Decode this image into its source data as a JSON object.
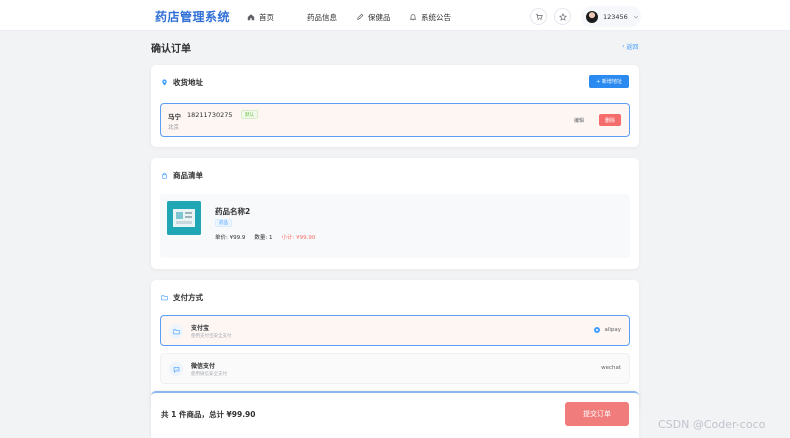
{
  "header": {
    "logo": "药店管理系统",
    "nav": [
      {
        "label": "首页",
        "icon": "home-icon"
      },
      {
        "label": "药品信息",
        "icon": ""
      },
      {
        "label": "保健品",
        "icon": "edit-icon"
      },
      {
        "label": "系统公告",
        "icon": "bell-icon"
      }
    ],
    "cart_icon": "cart-icon",
    "star_icon": "star-icon",
    "user": {
      "name": "123456"
    }
  },
  "page": {
    "title": "确认订单",
    "back_label": "返回"
  },
  "address": {
    "title": "收货地址",
    "add_label": "+ 新增地址",
    "entry": {
      "name": "马宁",
      "phone": "18211730275",
      "tag": "默认",
      "detail": "北京",
      "edit_label": "编辑",
      "delete_label": "删除"
    }
  },
  "goods": {
    "title": "商品清单",
    "items": [
      {
        "name": "药品名称2",
        "tag": "药品",
        "unit_price_label": "单价: ¥99.9",
        "qty_label": "数量: 1",
        "subtotal_label": "小计: ¥99.90"
      }
    ]
  },
  "payment": {
    "title": "支付方式",
    "options": [
      {
        "name": "支付宝",
        "desc": "使用支付宝安全支付",
        "value": "alipay",
        "selected": true
      },
      {
        "name": "微信支付",
        "desc": "使用微信安全支付",
        "value": "wechat",
        "selected": false
      }
    ]
  },
  "footer": {
    "summary": "共 1 件商品，总计 ¥99.90",
    "submit_label": "提交订单"
  },
  "watermark": "CSDN @Coder-coco",
  "colors": {
    "primary": "#2b8af0",
    "danger": "#f56c6c",
    "logo": "#2f6fd6"
  }
}
